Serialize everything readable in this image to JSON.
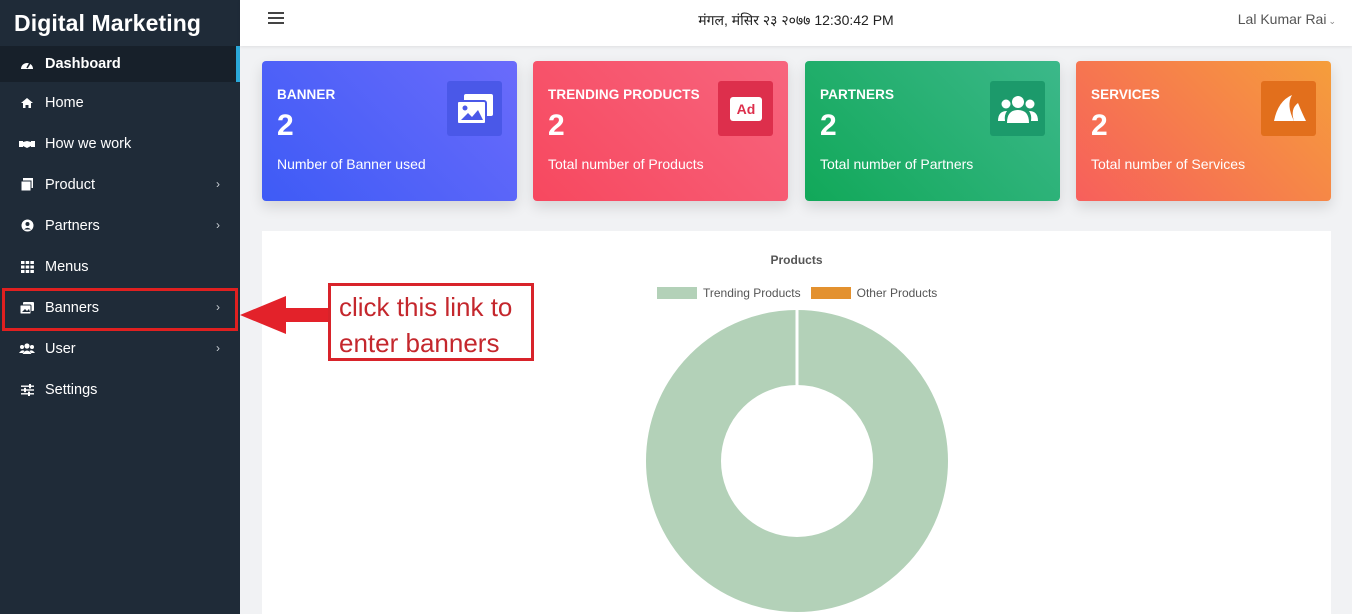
{
  "app": {
    "title": "Digital Marketing"
  },
  "sidebar": {
    "items": [
      {
        "label": "Dashboard",
        "icon": "dashboard-icon",
        "active": true,
        "has_submenu": false
      },
      {
        "label": "Home",
        "icon": "home-icon",
        "has_submenu": false
      },
      {
        "label": "How we work",
        "icon": "handshake-icon",
        "has_submenu": false
      },
      {
        "label": "Product",
        "icon": "box-icon",
        "has_submenu": true
      },
      {
        "label": "Partners",
        "icon": "user-circle-icon",
        "has_submenu": true
      },
      {
        "label": "Menus",
        "icon": "grid-icon",
        "has_submenu": false
      },
      {
        "label": "Banners",
        "icon": "images-icon",
        "has_submenu": true
      },
      {
        "label": "User",
        "icon": "users-icon",
        "has_submenu": true
      },
      {
        "label": "Settings",
        "icon": "sliders-icon",
        "has_submenu": false
      }
    ]
  },
  "topbar": {
    "datetime": "मंगल, मंसिर २३ २०७७ 12:30:42 PM",
    "user_name": "Lal Kumar Rai"
  },
  "cards": [
    {
      "title": "BANNER",
      "value": "2",
      "desc": "Number of Banner used",
      "icon": "images-icon"
    },
    {
      "title": "TRENDING PRODUCTS",
      "value": "2",
      "desc": "Total number of Products",
      "icon": "ad-icon"
    },
    {
      "title": "PARTNERS",
      "value": "2",
      "desc": "Total number of Partners",
      "icon": "users-icon"
    },
    {
      "title": "SERVICES",
      "value": "2",
      "desc": "Total number of Services",
      "icon": "shark-fin-icon"
    }
  ],
  "chart_data": {
    "type": "pie",
    "title": "Products",
    "labels": [
      "Trending Products",
      "Other Products"
    ],
    "values": [
      2,
      0
    ],
    "colors": [
      "#b3d1b8",
      "#e3912f"
    ],
    "legend": "top"
  },
  "annotation": {
    "text_line1": "click this link to",
    "text_line2": "enter banners",
    "color": "#e02020"
  }
}
